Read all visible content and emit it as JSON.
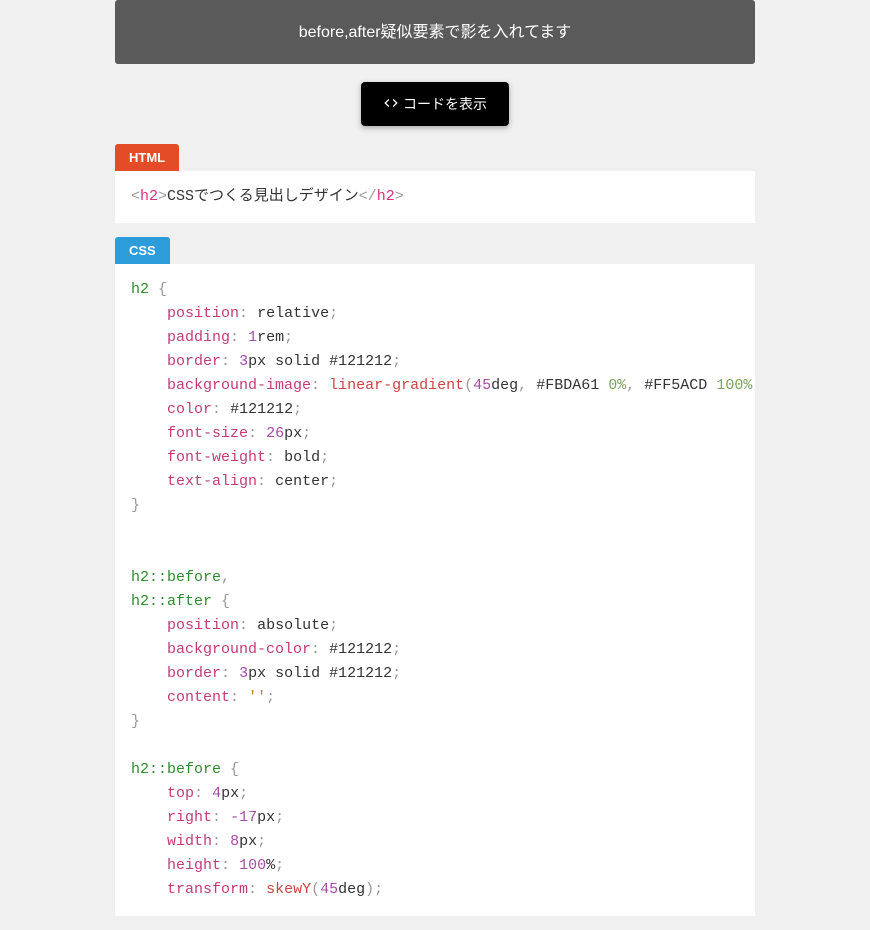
{
  "banner": {
    "text": "before,after疑似要素で影を入れてます"
  },
  "button": {
    "label": "コードを表示"
  },
  "tabs": {
    "html": "HTML",
    "css": "CSS"
  },
  "html_code": {
    "open_tag": "h2",
    "content": "CSSでつくる見出しデザイン",
    "close_tag": "h2"
  },
  "css_code": {
    "r1_sel": "h2",
    "r1_decls": [
      {
        "prop": "position",
        "val": "relative"
      },
      {
        "prop": "padding",
        "num": "1",
        "unit": "rem"
      },
      {
        "prop": "border",
        "num": "3",
        "unit": "px",
        "rest": " solid #121212"
      },
      {
        "prop": "background-image",
        "func": "linear-gradient",
        "args_a": "45",
        "args_a_unit": "deg",
        "c1": "#FBDA61",
        "p1": "0",
        "c2": "#FF5ACD",
        "p2": "100"
      },
      {
        "prop": "color",
        "hex": "#121212"
      },
      {
        "prop": "font-size",
        "num": "26",
        "unit": "px"
      },
      {
        "prop": "font-weight",
        "val": "bold"
      },
      {
        "prop": "text-align",
        "val": "center"
      }
    ],
    "r2_sel_a": "h2::before",
    "r2_sel_b": "h2::after",
    "r2_decls": [
      {
        "prop": "position",
        "val": "absolute"
      },
      {
        "prop": "background-color",
        "hex": "#121212"
      },
      {
        "prop": "border",
        "num": "3",
        "unit": "px",
        "rest": " solid #121212"
      },
      {
        "prop": "content",
        "str": "''"
      }
    ],
    "r3_sel": "h2::before",
    "r3_decls": [
      {
        "prop": "top",
        "num": "4",
        "unit": "px"
      },
      {
        "prop": "right",
        "num": "-17",
        "unit": "px"
      },
      {
        "prop": "width",
        "num": "8",
        "unit": "px"
      },
      {
        "prop": "height",
        "num": "100",
        "unit": "%"
      },
      {
        "prop": "transform",
        "func": "skewY",
        "args_a": "45",
        "args_a_unit": "deg"
      }
    ]
  }
}
